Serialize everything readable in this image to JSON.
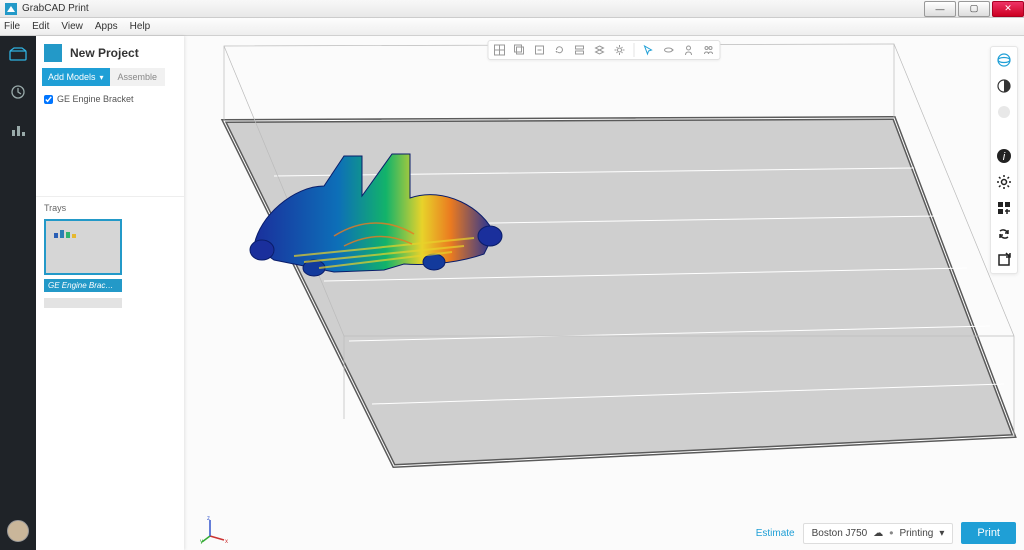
{
  "window": {
    "title": "GrabCAD Print"
  },
  "menu": {
    "file": "File",
    "edit": "Edit",
    "view": "View",
    "apps": "Apps",
    "help": "Help"
  },
  "panel": {
    "title": "New Project",
    "add_models": "Add Models",
    "assemble": "Assemble",
    "model_item": "GE Engine Bracket",
    "trays_label": "Trays",
    "tray_caption": "GE Engine Brac…"
  },
  "footer": {
    "estimate": "Estimate",
    "printer_name": "Boston J750",
    "printer_status": "Printing",
    "print": "Print"
  },
  "toolbar_icons": [
    "grid",
    "copy",
    "clone",
    "refresh",
    "stack",
    "layers",
    "config",
    "select",
    "rotate",
    "person",
    "group"
  ],
  "right_tools": [
    "orbit",
    "shade",
    "sphere",
    "info",
    "settings",
    "arrange",
    "sync",
    "expand"
  ]
}
